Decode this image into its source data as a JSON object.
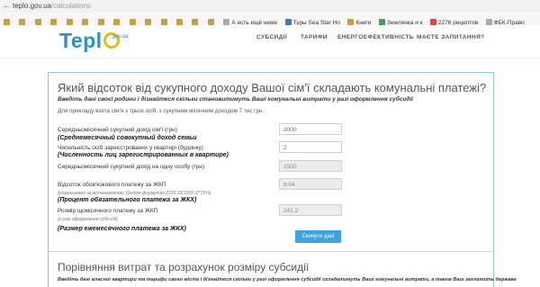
{
  "browser": {
    "url_host": "teplo.gov.ua",
    "url_path": "/calculations",
    "bookmarks": [
      {
        "label": "",
        "color": "#c9a13a"
      },
      {
        "label": "",
        "color": "#c9a13a"
      },
      {
        "label": "",
        "color": "#c9a13a"
      },
      {
        "label": "",
        "color": "#c9a13a"
      },
      {
        "label": "",
        "color": "#c9a13a"
      },
      {
        "label": "",
        "color": "#c9a13a"
      },
      {
        "label": "",
        "color": "#c9a13a"
      },
      {
        "label": "",
        "color": "#c9a13a"
      },
      {
        "label": "",
        "color": "#c9a13a"
      },
      {
        "label": "",
        "color": "#c9a13a"
      },
      {
        "label": "",
        "color": "#c9a13a"
      },
      {
        "label": "",
        "color": "#c9a13a"
      },
      {
        "label": "",
        "color": "#c9a13a"
      },
      {
        "label": "",
        "color": "#c9a13a"
      }
    ],
    "bookmarks_named": [
      "А есть ещё неме",
      "Туры Sea Star Ho",
      "Книги",
      "Землянка и к",
      "2276 рецептов",
      "ФБК-Право"
    ]
  },
  "site": {
    "logo_text": "Tepl",
    "logo_sub": ".gov.ua",
    "nav": [
      "СУБСИДІЇ",
      "ТАРИФИ",
      "ЕНЕРГОЕФЕКТИВНІСТЬ",
      "МАЄТЕ ЗАПИТАННЯ?"
    ]
  },
  "calculator": {
    "title": "Який відсоток від сукупного доходу Вашої сім'ї складають комунальні платежі?",
    "instruction": "Введіть дані своєї родини і дізнайтеся скільки становитимуть Ваші комунальні витрати у разі оформлення субсидії",
    "example": "Для прикладу взята сім'я з трьох осіб, з сукупним місячним доходом 7 тис грн.",
    "fields": [
      {
        "label": "Середньомісячний сукупний дохід сім'ї (грн)",
        "annotation": "(Среднемесячный совокупный доход семьи",
        "value": "3000",
        "readonly": false
      },
      {
        "label": "Чисельність осіб зареєстрованих у квартирі (будинку)",
        "annotation": "(Численность лиц зарегистрированных в квартире)",
        "value": "2",
        "readonly": false
      },
      {
        "label": "Середньомісячний сукупний дохід на одну особу (грн)",
        "annotation": "",
        "value": "1500",
        "readonly": true
      },
      {
        "label": "Відсоток обов'язкового платежу за ЖКП",
        "sublabel": "(розраховано за встановленою Урядом формулою 2333.33/1399 (2*15%)",
        "annotation": "(Процент обязательного платежа за ЖКХ)",
        "value": "8.04",
        "readonly": true
      },
      {
        "label": "Розмір щомісячного платежу за ЖКП",
        "sublabel": "(у разі оформлення субсидії)",
        "annotation": "(Размер ежемесячного платежа за ЖКХ)",
        "value": "241.2",
        "readonly": true
      }
    ],
    "submit_label": "Скинути дані"
  },
  "comparison": {
    "title": "Порівняння витрат та розрахунок розміру субсидії",
    "instruction": "Введіть дані власної квартири та тарифи свого міста і дізнайтеся скільки у разі оформлення субсидії складатимуть Ваші комунальні витрати, а також Ваш заплатить держава"
  }
}
